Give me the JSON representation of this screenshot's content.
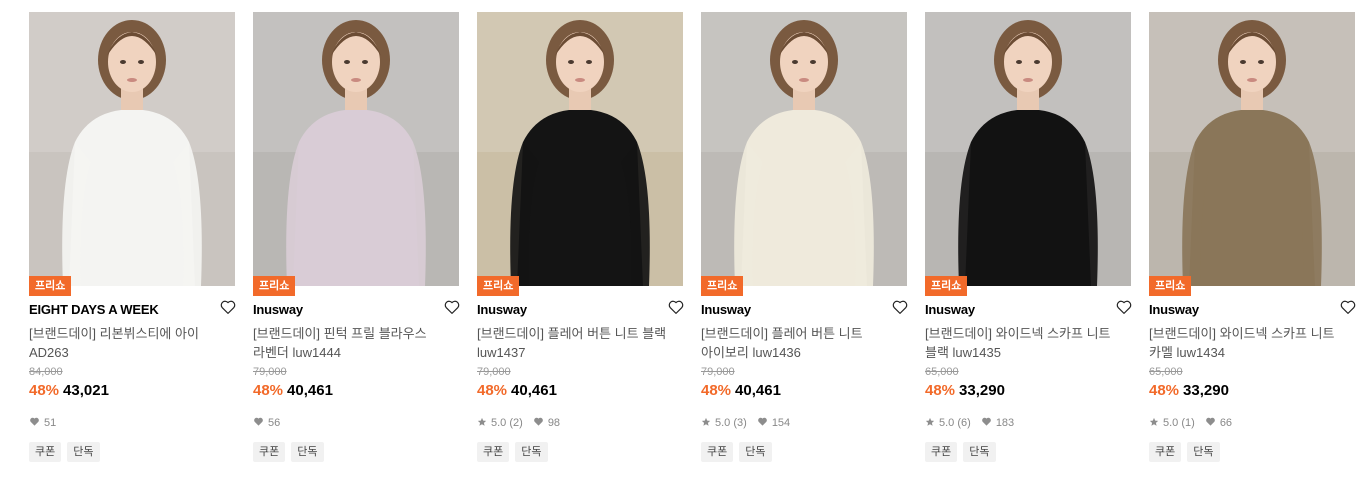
{
  "products": [
    {
      "badge": "프리쇼",
      "brand": "EIGHT DAYS A WEEK",
      "name": "[브랜드데이] 리본뷔스티에 아이 AD263",
      "original_price": "84,000",
      "discount": "48%",
      "price": "43,021",
      "rating": "",
      "reviews": "",
      "likes": "51",
      "tags": [
        "쿠폰",
        "단독"
      ],
      "top_color": "#f4f4f2",
      "bg_color": "#c9c4bf"
    },
    {
      "badge": "프리쇼",
      "brand": "Inusway",
      "name": "[브랜드데이] 핀턱 프릴 블라우스 라벤더 luw1444",
      "original_price": "79,000",
      "discount": "48%",
      "price": "40,461",
      "rating": "",
      "reviews": "",
      "likes": "56",
      "tags": [
        "쿠폰",
        "단독"
      ],
      "top_color": "#d9ccd6",
      "bg_color": "#b9b7b4"
    },
    {
      "badge": "프리쇼",
      "brand": "Inusway",
      "name": "[브랜드데이] 플레어 버튼 니트 블랙 luw1437",
      "original_price": "79,000",
      "discount": "48%",
      "price": "40,461",
      "rating": "5.0",
      "reviews": "(2)",
      "likes": "98",
      "tags": [
        "쿠폰",
        "단독"
      ],
      "top_color": "#141414",
      "bg_color": "#cbbfa6"
    },
    {
      "badge": "프리쇼",
      "brand": "Inusway",
      "name": "[브랜드데이] 플레어 버튼 니트 아이보리 luw1436",
      "original_price": "79,000",
      "discount": "48%",
      "price": "40,461",
      "rating": "5.0",
      "reviews": "(3)",
      "likes": "154",
      "tags": [
        "쿠폰",
        "단독"
      ],
      "top_color": "#efeadc",
      "bg_color": "#bdbab6"
    },
    {
      "badge": "프리쇼",
      "brand": "Inusway",
      "name": "[브랜드데이] 와이드넥 스카프 니트 블랙 luw1435",
      "original_price": "65,000",
      "discount": "48%",
      "price": "33,290",
      "rating": "5.0",
      "reviews": "(6)",
      "likes": "183",
      "tags": [
        "쿠폰",
        "단독"
      ],
      "top_color": "#121212",
      "bg_color": "#b8b6b3"
    },
    {
      "badge": "프리쇼",
      "brand": "Inusway",
      "name": "[브랜드데이] 와이드넥 스카프 니트 카멜 luw1434",
      "original_price": "65,000",
      "discount": "48%",
      "price": "33,290",
      "rating": "5.0",
      "reviews": "(1)",
      "likes": "66",
      "tags": [
        "쿠폰",
        "단독"
      ],
      "top_color": "#8a7659",
      "bg_color": "#bcb6ad"
    }
  ],
  "colors": {
    "accent": "#f26a2a",
    "muted": "#999999"
  },
  "icons": {
    "heart": "heart-icon",
    "star": "star-icon",
    "like": "heart-filled-icon"
  }
}
